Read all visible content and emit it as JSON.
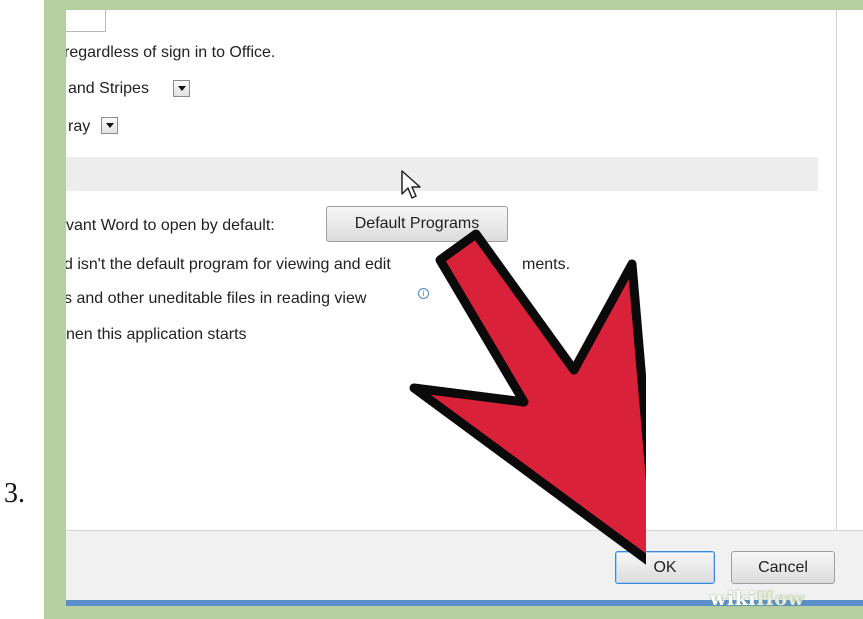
{
  "step_label": "3.",
  "options": {
    "sign_in_text": "regardless of sign in to Office.",
    "background_value": "and Stripes",
    "theme_value": "ray",
    "default_programs_prompt": "vant Word to open by default:",
    "default_programs_button": "Default Programs",
    "not_default_text": "d isn't the default program for viewing and edit",
    "not_default_text_tail": "ments.",
    "reading_view_text": "s and other uneditable files in reading view",
    "start_screen_text": "nen this application starts"
  },
  "footer": {
    "ok_label": "OK",
    "cancel_label": "Cancel"
  },
  "watermark": {
    "part1": "wiki",
    "part2": "How"
  },
  "icons": {
    "info": "info-icon",
    "cursor": "mouse-pointer-icon",
    "arrow": "red-pointer-arrow"
  },
  "colors": {
    "frame": "#b5cf9e",
    "arrow_fill": "#d9213a",
    "ok_border": "#3c8ad6"
  }
}
